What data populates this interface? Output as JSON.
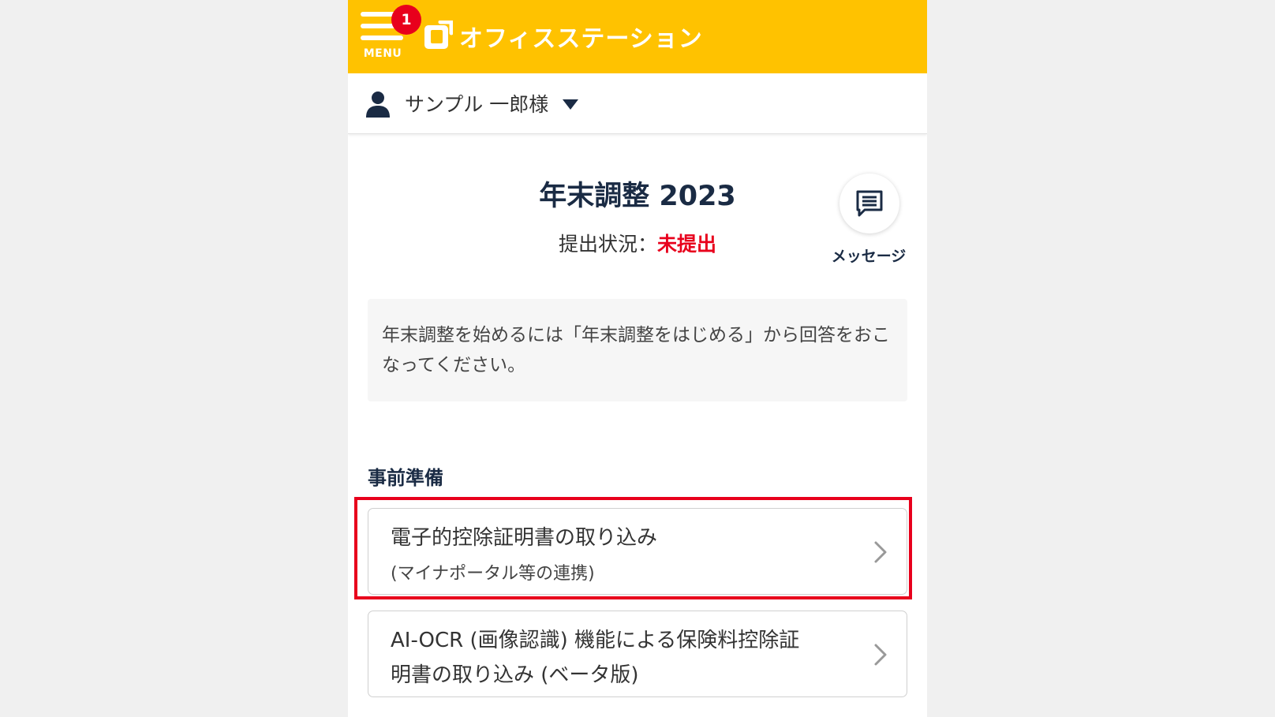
{
  "header": {
    "menu_label": "MENU",
    "badge_count": "1",
    "brand": "オフィスステーション",
    "brand_color": "#ffc200"
  },
  "user": {
    "name": "サンプル 一郎様",
    "icon": "user-icon",
    "dropdown_icon": "caret-down-icon"
  },
  "main": {
    "title": "年末調整 2023",
    "status_label": "提出状況：",
    "status_value": "未提出",
    "status_color": "#e8001c",
    "message_label": "メッセージ",
    "notice": "年末調整を始めるには「年末調整をはじめる」から回答をおこなってください。"
  },
  "section": {
    "title": "事前準備",
    "items": [
      {
        "line1": "電子的控除証明書の取り込み",
        "line2": "(マイナポータル等の連携)",
        "highlighted": true
      },
      {
        "line1": "AI-OCR (画像認識) 機能による保険料控除証",
        "line2": "明書の取り込み (ベータ版)",
        "highlighted": false
      }
    ]
  }
}
